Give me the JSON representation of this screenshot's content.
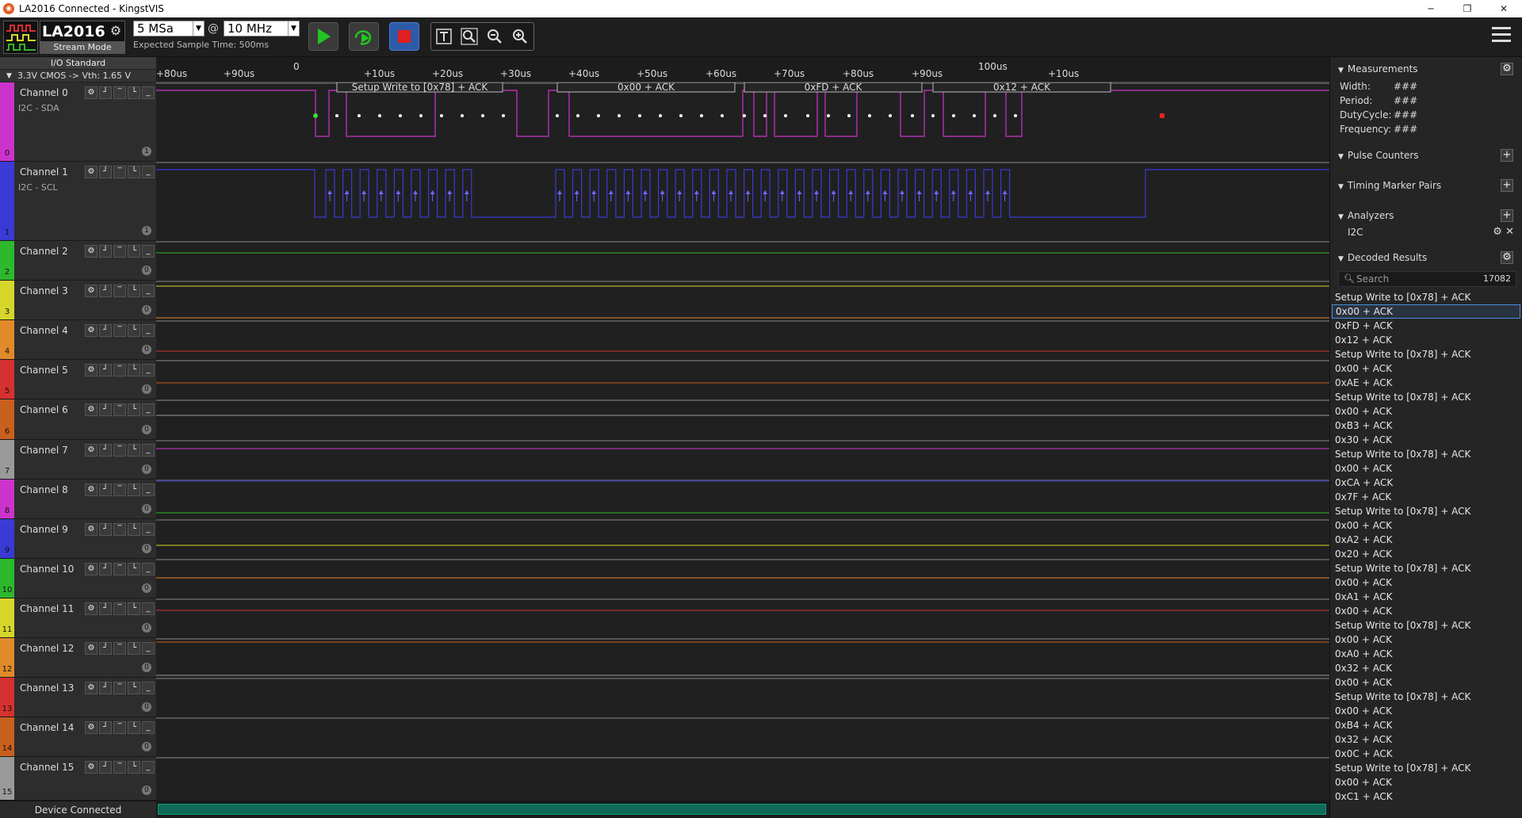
{
  "window": {
    "title": "LA2016 Connected - KingstVIS",
    "app_icon": "kingst-icon",
    "minimize": "─",
    "restore": "❐",
    "close": "✕"
  },
  "toolbar": {
    "device_name": "LA2016",
    "device_mode": "Stream Mode",
    "sample_depth": "5 MSa",
    "at_sign": "@",
    "sample_rate": "10 MHz",
    "expected_time": "Expected Sample Time: 500ms"
  },
  "io": {
    "standard_label": "I/O Standard",
    "setting": "3.3V CMOS -> Vth: 1.65 V"
  },
  "channels": [
    {
      "name": "Channel 0",
      "sub": "I2C - SDA",
      "num": "0",
      "badge": "1",
      "color": "#cc33cc"
    },
    {
      "name": "Channel 1",
      "sub": "I2C - SCL",
      "num": "1",
      "badge": "1",
      "color": "#3a3ad6"
    },
    {
      "name": "Channel 2",
      "sub": "",
      "num": "2",
      "badge": "0",
      "color": "#2db82d"
    },
    {
      "name": "Channel 3",
      "sub": "",
      "num": "3",
      "badge": "0",
      "color": "#d6d62a"
    },
    {
      "name": "Channel 4",
      "sub": "",
      "num": "4",
      "badge": "0",
      "color": "#e08a2a"
    },
    {
      "name": "Channel 5",
      "sub": "",
      "num": "5",
      "badge": "0",
      "color": "#d63030"
    },
    {
      "name": "Channel 6",
      "sub": "",
      "num": "6",
      "badge": "0",
      "color": "#c8601e"
    },
    {
      "name": "Channel 7",
      "sub": "",
      "num": "7",
      "badge": "0",
      "color": "#9a9a9a"
    },
    {
      "name": "Channel 8",
      "sub": "",
      "num": "8",
      "badge": "0",
      "color": "#cc33cc"
    },
    {
      "name": "Channel 9",
      "sub": "",
      "num": "9",
      "badge": "0",
      "color": "#3a3ad6"
    },
    {
      "name": "Channel 10",
      "sub": "",
      "num": "10",
      "badge": "0",
      "color": "#2db82d"
    },
    {
      "name": "Channel 11",
      "sub": "",
      "num": "11",
      "badge": "0",
      "color": "#d6d62a"
    },
    {
      "name": "Channel 12",
      "sub": "",
      "num": "12",
      "badge": "0",
      "color": "#e08a2a"
    },
    {
      "name": "Channel 13",
      "sub": "",
      "num": "13",
      "badge": "0",
      "color": "#d63030"
    },
    {
      "name": "Channel 14",
      "sub": "",
      "num": "14",
      "badge": "0",
      "color": "#c8601e"
    },
    {
      "name": "Channel 15",
      "sub": "",
      "num": "15",
      "badge": "0",
      "color": "#9a9a9a"
    }
  ],
  "status": {
    "text": "Device Connected"
  },
  "ruler": {
    "labels": [
      "+80us",
      "+90us",
      "0",
      "+10us",
      "+20us",
      "+30us",
      "+40us",
      "+50us",
      "+60us",
      "+70us",
      "+80us",
      "+90us",
      "100us",
      "+10us"
    ]
  },
  "packets": [
    "Setup Write to [0x78] + ACK",
    "0x00 + ACK",
    "0xFD + ACK",
    "0x12 + ACK"
  ],
  "panel": {
    "measurements": "Measurements",
    "width_label": "Width:",
    "period_label": "Period:",
    "duty_label": "DutyCycle:",
    "freq_label": "Frequency:",
    "meas_value": "###",
    "pulse_counters": "Pulse Counters",
    "timing_markers": "Timing Marker Pairs",
    "analyzers": "Analyzers",
    "analyzer_i2c": "I2C",
    "decoded_results": "Decoded Results",
    "search_placeholder": "Search",
    "result_count": "17082"
  },
  "results": [
    "Setup Write to [0x78] + ACK",
    "0x00 + ACK",
    "0xFD + ACK",
    "0x12 + ACK",
    "Setup Write to [0x78] + ACK",
    "0x00 + ACK",
    "0xAE + ACK",
    "Setup Write to [0x78] + ACK",
    "0x00 + ACK",
    "0xB3 + ACK",
    "0x30 + ACK",
    "Setup Write to [0x78] + ACK",
    "0x00 + ACK",
    "0xCA + ACK",
    "0x7F + ACK",
    "Setup Write to [0x78] + ACK",
    "0x00 + ACK",
    "0xA2 + ACK",
    "0x20 + ACK",
    "Setup Write to [0x78] + ACK",
    "0x00 + ACK",
    "0xA1 + ACK",
    "0x00 + ACK",
    "Setup Write to [0x78] + ACK",
    "0x00 + ACK",
    "0xA0 + ACK",
    "0x32 + ACK",
    "0x00 + ACK",
    "Setup Write to [0x78] + ACK",
    "0x00 + ACK",
    "0xB4 + ACK",
    "0x32 + ACK",
    "0x0C + ACK",
    "Setup Write to [0x78] + ACK",
    "0x00 + ACK",
    "0xC1 + ACK"
  ],
  "selected_result_index": 1
}
